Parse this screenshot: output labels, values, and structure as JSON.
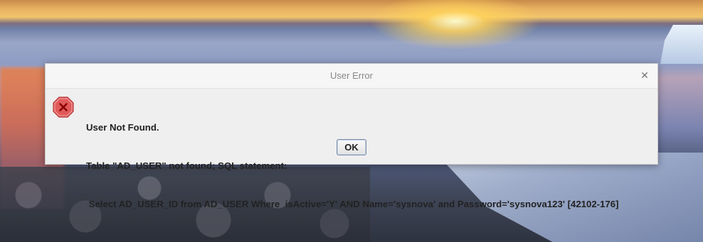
{
  "dialog": {
    "title": "User Error",
    "close_glyph": "✕",
    "icon": "error-octagon-icon",
    "message_lines": [
      "User Not Found.",
      "Table \"AD_USER\" not found; SQL statement:",
      " Select AD_USER_ID from AD_USER Where  isActive='Y' AND Name='sysnova' and Password='sysnova123' [42102-176]"
    ],
    "ok_label": "OK"
  },
  "colors": {
    "dialog_bg": "#efefef",
    "error_icon_fill": "#e05a5a",
    "error_icon_x": "#8b0000"
  }
}
